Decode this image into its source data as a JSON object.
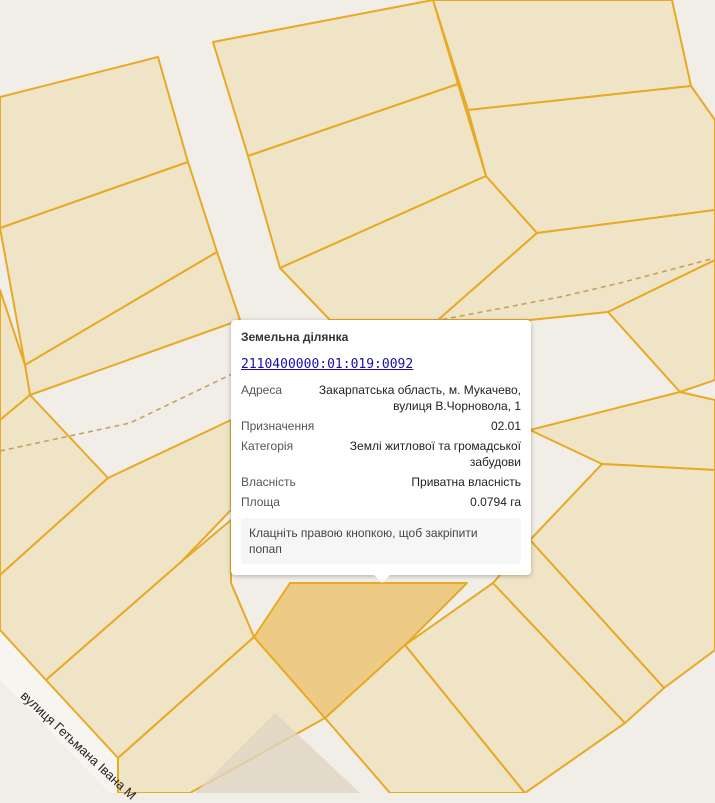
{
  "map": {
    "colors": {
      "background": "#f1eee8",
      "parcel_fill": "#f0e4c6",
      "parcel_border": "#e8a925",
      "selected_parcel_fill": "#eecb84",
      "boundary_dash": "#c8a060"
    },
    "street_label": "вулиця Гетьмана Івана М"
  },
  "popup": {
    "title": "Земельна ділянка",
    "cadastral_number": "2110400000:01:019:0092",
    "rows": [
      {
        "label": "Адреса",
        "value_line1": "Закарпатська область, м. Мукачево,",
        "value_line2": "вулиця В.Чорновола, 1"
      },
      {
        "label": "Призначення",
        "value_line1": "02.01"
      },
      {
        "label": "Категорія",
        "value_line1": "Землі житлової та громадської",
        "value_line2": "забудови"
      },
      {
        "label": "Власність",
        "value_line1": "Приватна власність"
      },
      {
        "label": "Площа",
        "value_line1": "0.0794 га"
      }
    ],
    "hint": "Клацніть правою кнопкою, щоб закріпити попап"
  }
}
